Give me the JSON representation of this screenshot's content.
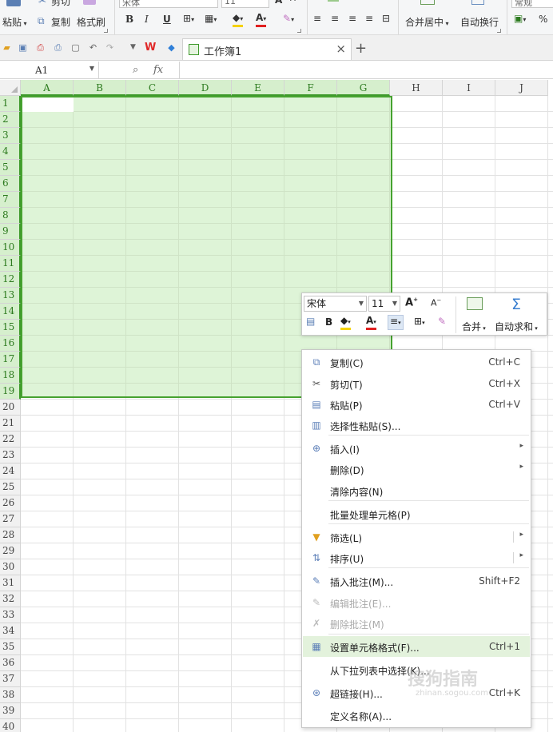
{
  "ribbon": {
    "cut_label": "剪切",
    "font_name": "宋体",
    "font_size": "11",
    "paste_label": "粘贴",
    "copy_label": "复制",
    "format_painter_label": "格式刷",
    "merge_center_label": "合并居中",
    "wrap_text_label": "自动换行",
    "number_format": "常规",
    "percent": "%",
    "bold": "B",
    "italic": "I",
    "underline": "U",
    "font_color_letter": "A",
    "grow_font": "A",
    "shrink_font": "A"
  },
  "tabs": {
    "workbook_label": "工作簿1",
    "add": "+",
    "close": "×"
  },
  "formula_bar": {
    "cell_ref": "A1",
    "fx": "fx"
  },
  "grid": {
    "columns": [
      "A",
      "B",
      "C",
      "D",
      "E",
      "F",
      "G",
      "H",
      "I",
      "J"
    ],
    "selected_columns": [
      "A",
      "B",
      "C",
      "D",
      "E",
      "F",
      "G"
    ],
    "rows": [
      "1",
      "2",
      "3",
      "4",
      "5",
      "6",
      "7",
      "8",
      "9",
      "10",
      "11",
      "12",
      "13",
      "14",
      "15",
      "16",
      "17",
      "18",
      "19",
      "20",
      "21",
      "22",
      "23",
      "24",
      "25",
      "26",
      "27",
      "28",
      "29",
      "30",
      "31",
      "32",
      "33",
      "34",
      "35",
      "36",
      "37",
      "38",
      "39",
      "40"
    ],
    "selected_rows_to": 19
  },
  "mini_toolbar": {
    "font_name": "宋体",
    "font_size": "11",
    "grow": "A",
    "shrink": "A",
    "bold": "B",
    "font_color": "A",
    "merge_label": "合并",
    "autosum_label": "自动求和",
    "sigma": "Σ"
  },
  "context_menu": {
    "items": [
      {
        "label": "复制(C)",
        "shortcut": "Ctrl+C",
        "icon": "copy-icon"
      },
      {
        "label": "剪切(T)",
        "shortcut": "Ctrl+X",
        "icon": "scissors-icon"
      },
      {
        "label": "粘贴(P)",
        "shortcut": "Ctrl+V",
        "icon": "paste-icon"
      },
      {
        "label": "选择性粘贴(S)...",
        "shortcut": "",
        "icon": "paste-special-icon"
      },
      {
        "label": "插入(I)",
        "shortcut": "",
        "icon": "insert-icon"
      },
      {
        "label": "删除(D)",
        "shortcut": "",
        "icon": ""
      },
      {
        "label": "清除内容(N)",
        "shortcut": "",
        "icon": ""
      },
      {
        "label": "批量处理单元格(P)",
        "shortcut": "",
        "icon": ""
      },
      {
        "label": "筛选(L)",
        "shortcut": "",
        "icon": "filter-icon"
      },
      {
        "label": "排序(U)",
        "shortcut": "",
        "icon": "sort-icon"
      },
      {
        "label": "插入批注(M)...",
        "shortcut": "Shift+F2",
        "icon": "comment-icon"
      },
      {
        "label": "编辑批注(E)...",
        "shortcut": "",
        "icon": "edit-comment-icon"
      },
      {
        "label": "删除批注(M)",
        "shortcut": "",
        "icon": "delete-comment-icon"
      },
      {
        "label": "设置单元格格式(F)...",
        "shortcut": "Ctrl+1",
        "icon": "format-cells-icon"
      },
      {
        "label": "从下拉列表中选择(K)...",
        "shortcut": "",
        "icon": ""
      },
      {
        "label": "超链接(H)...",
        "shortcut": "Ctrl+K",
        "icon": "hyperlink-icon"
      },
      {
        "label": "定义名称(A)...",
        "shortcut": "",
        "icon": ""
      }
    ]
  },
  "watermark": {
    "text": "搜狗指南",
    "url_text": "zhinan.sogou.com"
  },
  "colors": {
    "selection_border": "#46a22f",
    "selection_fill": "#c8ecbc",
    "menu_highlight": "#e3f2dc"
  }
}
